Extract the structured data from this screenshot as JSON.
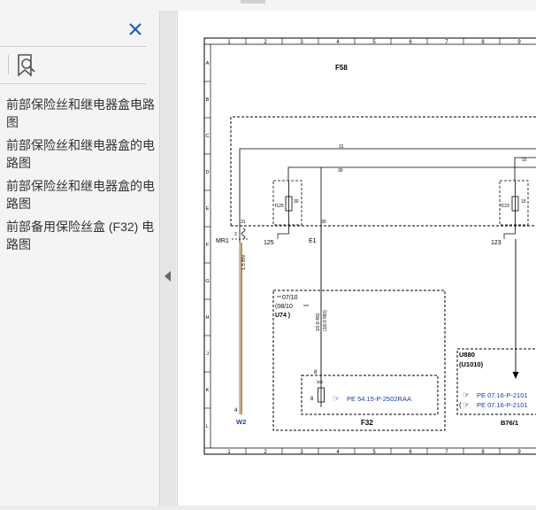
{
  "sidebar": {
    "bookmarks": [
      {
        "label": "前部保险丝和继电器盒电路图"
      },
      {
        "label": "前部保险丝和继电器盒的电路图"
      },
      {
        "label": "前部保险丝和继电器盒的电路图"
      },
      {
        "label": "前部备用保险丝盒 (F32) 电路图"
      }
    ]
  },
  "diagram": {
    "col_numbers": [
      "1",
      "2",
      "3",
      "4",
      "5",
      "6",
      "7",
      "8",
      "9"
    ],
    "row_letters": [
      "A",
      "B",
      "C",
      "D",
      "E",
      "F",
      "G",
      "H",
      "J",
      "K",
      "L"
    ],
    "title_f58": "F58",
    "wire_31": "31",
    "wire_30": "30",
    "wire_15": "15",
    "pin_31": "31",
    "pin_30_left": "30",
    "pin_30_right": "30",
    "pin_15": "15",
    "fuse_f125": "f125",
    "fuse_f123": "f123",
    "fuse_f125_box": "125",
    "fuse_f123_box": "123",
    "mr1": "MR1",
    "mr1_pin": "2",
    "e1": "E1",
    "wire_bn": "1.5 BN",
    "wire_rd_a": "10.0 RD",
    "wire_rd_b": "(16.0 RD)",
    "date_a": "07/10",
    "date_b": "(08/10",
    "date_c": "U74 )",
    "pin_8": "8",
    "pin_30z": "30z",
    "fuse_8": "8",
    "ref_f32": "PE 54.15-P-2502RAA",
    "f32": "F32",
    "pin_4": "4",
    "w2": "W2",
    "u880": "U880",
    "u1010": "(U1010)",
    "ref_pe1": "PE 07.16-P-2101",
    "ref_pe2": "PE 07.16-P-2101",
    "b76": "B76/1"
  }
}
